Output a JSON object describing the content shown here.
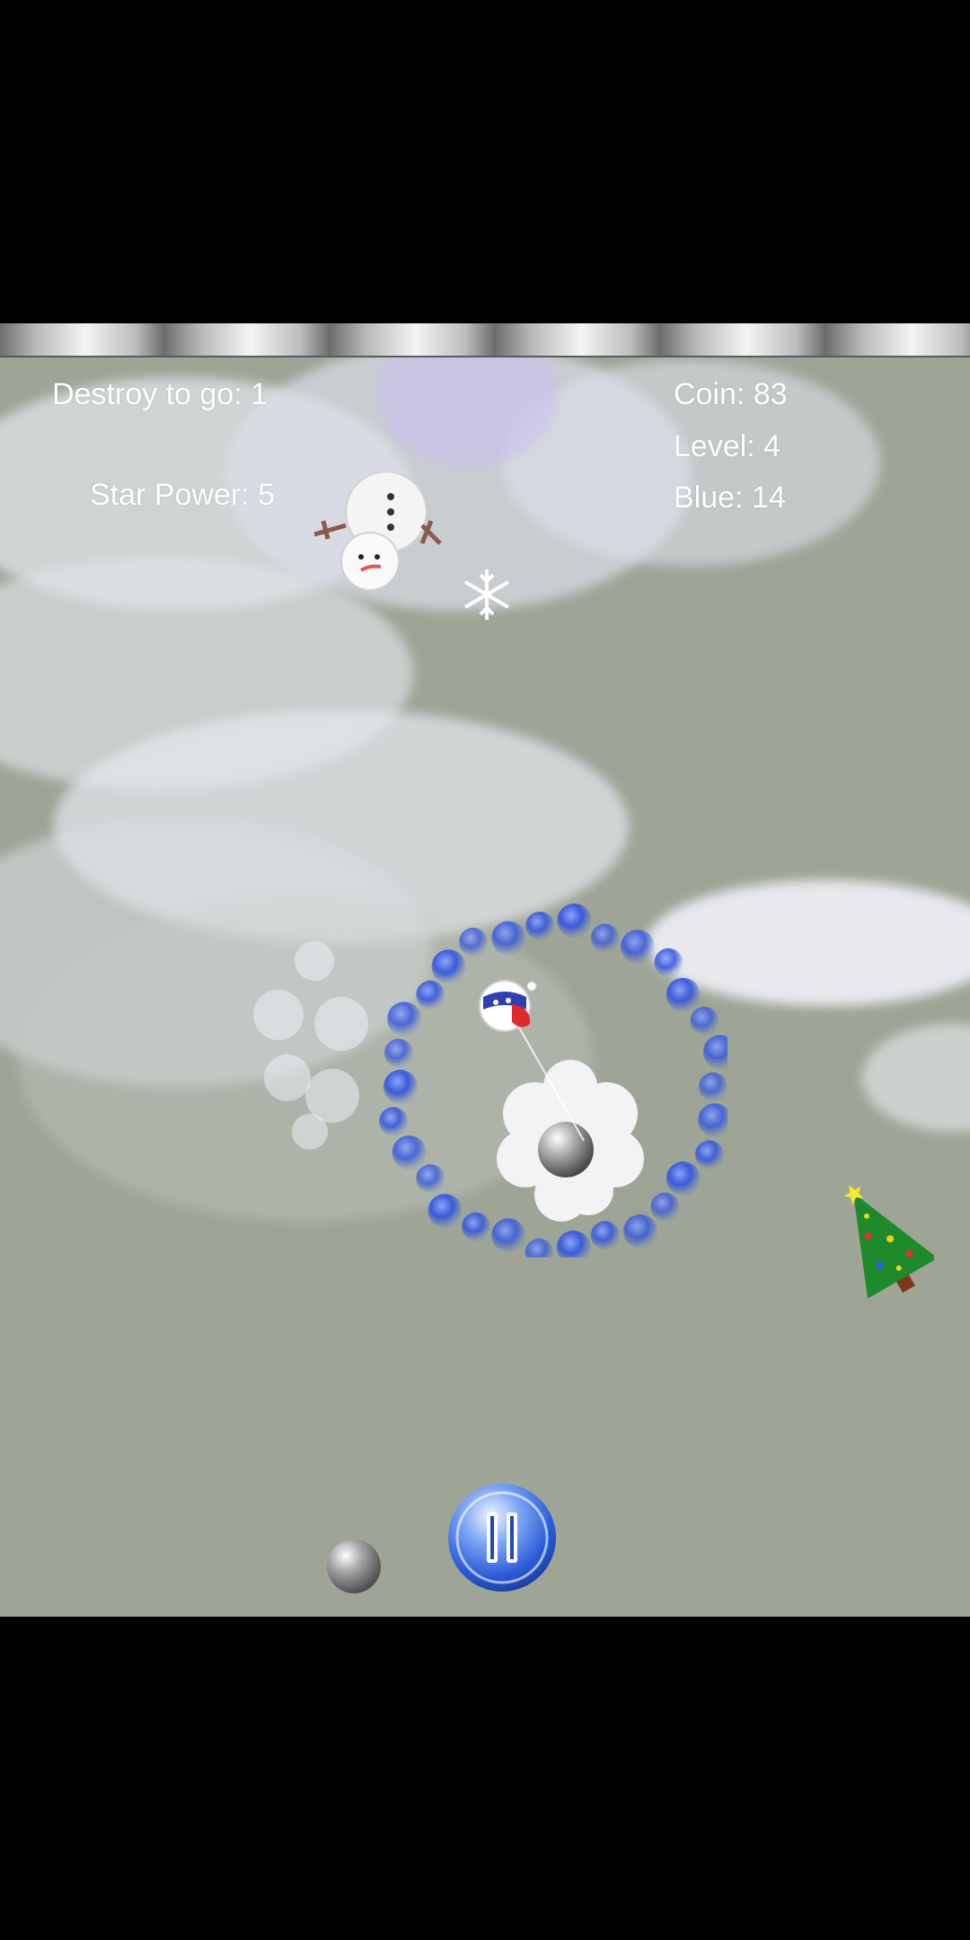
{
  "hud": {
    "destroy_to_go": "Destroy to go: 1",
    "star_power": "Star Power: 5",
    "coin": "Coin: 83",
    "level": "Level: 4",
    "blue": "Blue: 14"
  },
  "icons": {
    "snowman": "snowman-icon",
    "snowflake": "snowflake-icon",
    "tree": "christmas-tree-icon",
    "pause": "pause-icon",
    "ball": "silver-ball-icon",
    "santa_ball": "santa-ball-icon"
  },
  "colors": {
    "background": "#9ea597",
    "hud_text": "#ffffff",
    "bubble_blue": "#2f4fd6",
    "pause_blue": "#2a5bd7",
    "tree_green": "#1e8a2b"
  }
}
